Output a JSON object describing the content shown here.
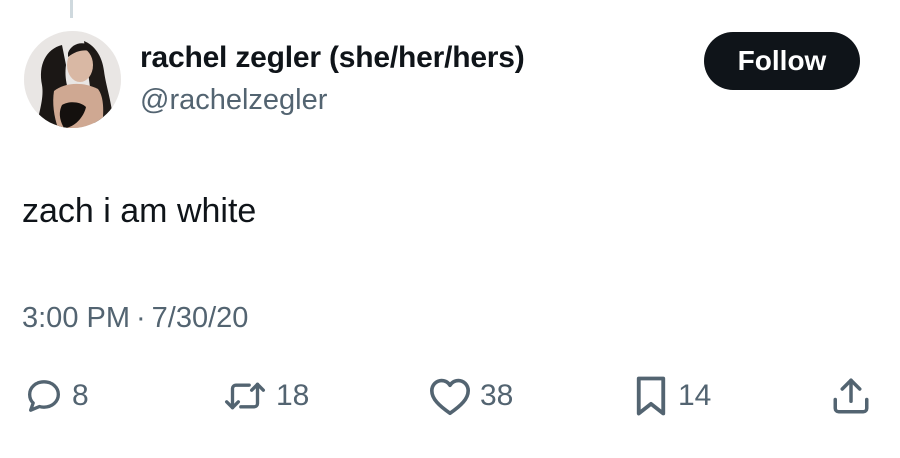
{
  "tweet": {
    "author": {
      "display_name": "rachel zegler (she/her/hers)",
      "handle": "@rachelzegler"
    },
    "follow_label": "Follow",
    "text": "zach i am white",
    "time": "3:00 PM",
    "separator": "·",
    "date": "7/30/20",
    "actions": {
      "reply": {
        "icon": "reply-icon",
        "count": "8"
      },
      "retweet": {
        "icon": "retweet-icon",
        "count": "18"
      },
      "like": {
        "icon": "heart-icon",
        "count": "38"
      },
      "bookmark": {
        "icon": "bookmark-icon",
        "count": "14"
      },
      "share": {
        "icon": "share-icon"
      }
    }
  },
  "colors": {
    "text_primary": "#0f1419",
    "text_secondary": "#536471",
    "button_bg": "#0f1419",
    "button_text": "#ffffff",
    "thread_line": "#cfd9de",
    "background": "#ffffff"
  }
}
